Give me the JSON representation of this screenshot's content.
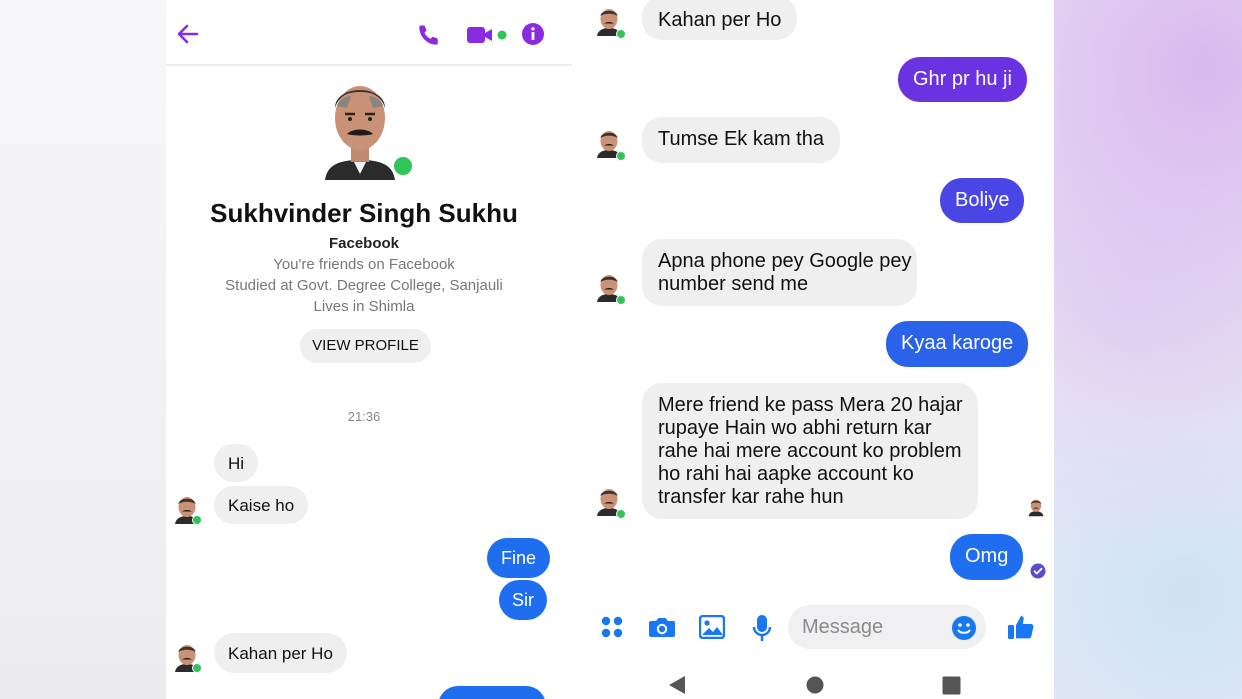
{
  "colors": {
    "accent_purple": "#8a2be2",
    "bubble_incoming": "#efeff0",
    "bubble_blue": "#1f6ef0",
    "bubble_purple": "#6a32e0",
    "online_green": "#31c45a",
    "composer_blue": "#1877f2"
  },
  "left_panel": {
    "header": {
      "back_icon": "arrow-left-icon",
      "call_icon": "phone-icon",
      "video_icon": "video-camera-icon",
      "info_icon": "info-icon"
    },
    "profile": {
      "name": "Sukhvinder Singh Sukhu",
      "platform": "Facebook",
      "friendship": "You're friends on Facebook",
      "education": "Studied at Govt. Degree College, Sanjauli",
      "location": "Lives in Shimla",
      "view_profile_label": "VIEW PROFILE"
    },
    "timestamp": "21:36",
    "messages": [
      {
        "direction": "in",
        "text": "Hi"
      },
      {
        "direction": "in",
        "text": "Kaise ho"
      },
      {
        "direction": "out",
        "text": "Fine"
      },
      {
        "direction": "out",
        "text": "Sir"
      },
      {
        "direction": "in",
        "text": "Kahan per Ho"
      }
    ]
  },
  "right_panel": {
    "messages": [
      {
        "direction": "in",
        "text": "Kahan per Ho"
      },
      {
        "direction": "out",
        "text": "Ghr pr hu ji"
      },
      {
        "direction": "in",
        "text": "Tumse Ek kam tha"
      },
      {
        "direction": "out",
        "text": "Boliye"
      },
      {
        "direction": "in",
        "lines": [
          "Apna phone pey Google pey",
          "number send me"
        ]
      },
      {
        "direction": "out",
        "text": "Kyaa karoge"
      },
      {
        "direction": "in",
        "lines": [
          "Mere friend ke pass Mera 20 hajar",
          "rupaye Hain wo abhi return kar",
          "rahe hai mere account ko problem",
          "ho rahi hai aapke account ko",
          "transfer kar rahe hun"
        ]
      },
      {
        "direction": "out",
        "text": "Omg"
      }
    ],
    "composer": {
      "menu_icon": "four-dots-icon",
      "camera_icon": "camera-icon",
      "gallery_icon": "image-icon",
      "mic_icon": "microphone-icon",
      "placeholder": "Message",
      "emoji_icon": "smiley-icon",
      "like_icon": "thumbs-up-icon"
    },
    "nav": {
      "back_icon": "nav-back-icon",
      "home_icon": "nav-home-icon",
      "recents_icon": "nav-recents-icon"
    }
  }
}
